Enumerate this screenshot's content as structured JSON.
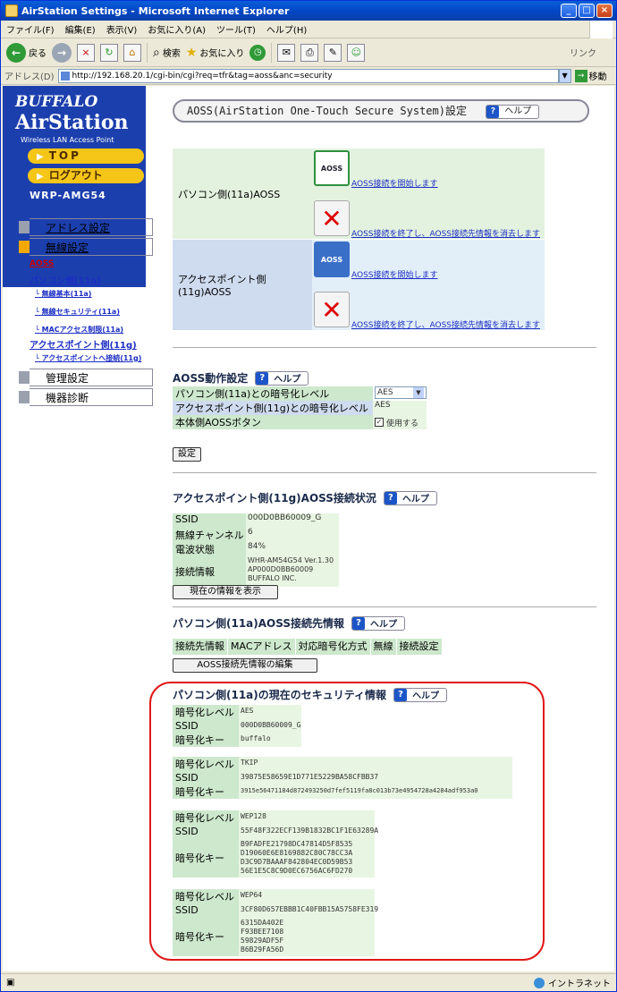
{
  "window": {
    "title": "AirStation Settings - Microsoft Internet Explorer"
  },
  "menubar": [
    "ファイル(F)",
    "編集(E)",
    "表示(V)",
    "お気に入り(A)",
    "ツール(T)",
    "ヘルプ(H)"
  ],
  "toolbar": {
    "back": "戻る",
    "search": "検索",
    "favorites": "お気に入り",
    "links": "リンク"
  },
  "address": {
    "label": "アドレス(D)",
    "url": "http://192.168.20.1/cgi-bin/cgi?req=tfr&tag=aoss&anc=security",
    "go": "移動"
  },
  "sidebar": {
    "brand1": "BUFFALO",
    "brand2": "AirStation",
    "brand3": "Wireless LAN Access Point",
    "top": "TOP",
    "logout": "ログアウト",
    "model": "WRP-AMG54",
    "address_settings": "アドレス設定",
    "wireless_settings": "無線設定",
    "aoss": "AOSS",
    "pc_side": "パソコン側(11a)",
    "wireless_basic": "無線基本(11a)",
    "wireless_security": "無線セキュリティ(11a)",
    "mac_access": "MACアクセス制限(11a)",
    "ap_side": "アクセスポイント側(11g)",
    "ap_connect": "アクセスポイントへ接続(11g)",
    "admin": "管理設定",
    "diagnosis": "機器診断"
  },
  "page": {
    "title": "AOSS(AirStation One-Touch Secure System)設定",
    "help": "ヘルプ"
  },
  "aoss": {
    "pc_label": "パソコン側(11a)AOSS",
    "ap_label": "アクセスポイント側(11g)AOSS",
    "start": "AOSS接続を開始します",
    "stop": "AOSS接続を終了し、AOSS接続先情報を消去します",
    "btn_text": "AOSS"
  },
  "operation": {
    "title": "AOSS動作設定",
    "pc_enc": "パソコン側(11a)との暗号化レベル",
    "pc_enc_val": "AES",
    "ap_enc": "アクセスポイント側(11g)との暗号化レベル",
    "ap_enc_val": "AES",
    "button": "本体側AOSSボタン",
    "button_val": "使用する",
    "submit": "設定"
  },
  "ap_status": {
    "title": "アクセスポイント側(11g)AOSS接続状況",
    "ssid_k": "SSID",
    "ssid_v": "000D0BB60009_G",
    "ch_k": "無線チャンネル",
    "ch_v": "6",
    "sig_k": "電波状態",
    "sig_v": "84%",
    "info_k": "接続情報",
    "info_v1": "WHR-AM54G54 Ver.1.30",
    "info_v2": "AP000D0BB60009",
    "info_v3": "BUFFALO INC.",
    "refresh": "現在の情報を表示"
  },
  "pc_conn": {
    "title": "パソコン側(11a)AOSS接続先情報",
    "cols": [
      "接続先情報",
      "MACアドレス",
      "対応暗号化方式",
      "無線",
      "接続設定"
    ],
    "edit": "AOSS接続先情報の編集"
  },
  "security": {
    "title": "パソコン側(11a)の現在のセキュリティ情報",
    "level_k": "暗号化レベル",
    "ssid_k": "SSID",
    "key_k": "暗号化キー",
    "aes": {
      "level": "AES",
      "ssid": "000D0BB60009_G",
      "key": [
        "buffalo"
      ]
    },
    "tkip": {
      "level": "TKIP",
      "ssid": "39875E58659E1D771E5229BA58CFBB37",
      "key": [
        "3915e56471184d872493250d7fef5119fa8c013b73e4954728a4284adf953a0"
      ]
    },
    "wep128": {
      "level": "WEP128",
      "ssid": "55F48F322ECF139B1832BC1F1E63289A",
      "key": [
        "B9FADFE21798DC47814D5F8535",
        "D19060E6E8169882C80C78CC3A",
        "D3C9D7BAAAF842804EC0D59B53",
        "56E1E5C8C9D0EC6756AC6FD270"
      ]
    },
    "wep64": {
      "level": "WEP64",
      "ssid": "3CF80D657EBBB1C40FBB15A5758FE319",
      "key": [
        "6315DA402E",
        "F93BEE7108",
        "59829ADF5F",
        "B6B29FA56D"
      ]
    }
  },
  "status": {
    "zone": "イントラネット"
  }
}
